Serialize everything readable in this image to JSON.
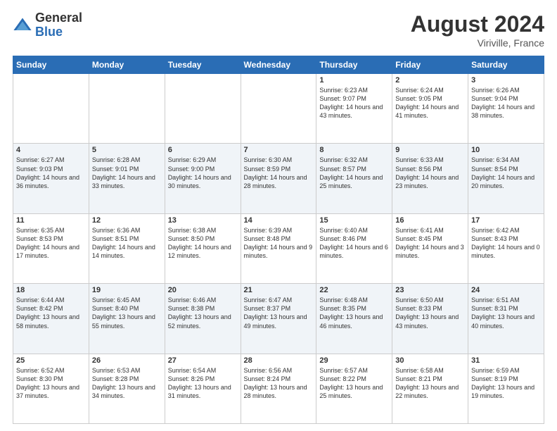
{
  "logo": {
    "general": "General",
    "blue": "Blue"
  },
  "title": "August 2024",
  "location": "Viriville, France",
  "days": [
    "Sunday",
    "Monday",
    "Tuesday",
    "Wednesday",
    "Thursday",
    "Friday",
    "Saturday"
  ],
  "weeks": [
    [
      {
        "day": "",
        "info": ""
      },
      {
        "day": "",
        "info": ""
      },
      {
        "day": "",
        "info": ""
      },
      {
        "day": "",
        "info": ""
      },
      {
        "day": "1",
        "info": "Sunrise: 6:23 AM\nSunset: 9:07 PM\nDaylight: 14 hours and 43 minutes."
      },
      {
        "day": "2",
        "info": "Sunrise: 6:24 AM\nSunset: 9:05 PM\nDaylight: 14 hours and 41 minutes."
      },
      {
        "day": "3",
        "info": "Sunrise: 6:26 AM\nSunset: 9:04 PM\nDaylight: 14 hours and 38 minutes."
      }
    ],
    [
      {
        "day": "4",
        "info": "Sunrise: 6:27 AM\nSunset: 9:03 PM\nDaylight: 14 hours and 36 minutes."
      },
      {
        "day": "5",
        "info": "Sunrise: 6:28 AM\nSunset: 9:01 PM\nDaylight: 14 hours and 33 minutes."
      },
      {
        "day": "6",
        "info": "Sunrise: 6:29 AM\nSunset: 9:00 PM\nDaylight: 14 hours and 30 minutes."
      },
      {
        "day": "7",
        "info": "Sunrise: 6:30 AM\nSunset: 8:59 PM\nDaylight: 14 hours and 28 minutes."
      },
      {
        "day": "8",
        "info": "Sunrise: 6:32 AM\nSunset: 8:57 PM\nDaylight: 14 hours and 25 minutes."
      },
      {
        "day": "9",
        "info": "Sunrise: 6:33 AM\nSunset: 8:56 PM\nDaylight: 14 hours and 23 minutes."
      },
      {
        "day": "10",
        "info": "Sunrise: 6:34 AM\nSunset: 8:54 PM\nDaylight: 14 hours and 20 minutes."
      }
    ],
    [
      {
        "day": "11",
        "info": "Sunrise: 6:35 AM\nSunset: 8:53 PM\nDaylight: 14 hours and 17 minutes."
      },
      {
        "day": "12",
        "info": "Sunrise: 6:36 AM\nSunset: 8:51 PM\nDaylight: 14 hours and 14 minutes."
      },
      {
        "day": "13",
        "info": "Sunrise: 6:38 AM\nSunset: 8:50 PM\nDaylight: 14 hours and 12 minutes."
      },
      {
        "day": "14",
        "info": "Sunrise: 6:39 AM\nSunset: 8:48 PM\nDaylight: 14 hours and 9 minutes."
      },
      {
        "day": "15",
        "info": "Sunrise: 6:40 AM\nSunset: 8:46 PM\nDaylight: 14 hours and 6 minutes."
      },
      {
        "day": "16",
        "info": "Sunrise: 6:41 AM\nSunset: 8:45 PM\nDaylight: 14 hours and 3 minutes."
      },
      {
        "day": "17",
        "info": "Sunrise: 6:42 AM\nSunset: 8:43 PM\nDaylight: 14 hours and 0 minutes."
      }
    ],
    [
      {
        "day": "18",
        "info": "Sunrise: 6:44 AM\nSunset: 8:42 PM\nDaylight: 13 hours and 58 minutes."
      },
      {
        "day": "19",
        "info": "Sunrise: 6:45 AM\nSunset: 8:40 PM\nDaylight: 13 hours and 55 minutes."
      },
      {
        "day": "20",
        "info": "Sunrise: 6:46 AM\nSunset: 8:38 PM\nDaylight: 13 hours and 52 minutes."
      },
      {
        "day": "21",
        "info": "Sunrise: 6:47 AM\nSunset: 8:37 PM\nDaylight: 13 hours and 49 minutes."
      },
      {
        "day": "22",
        "info": "Sunrise: 6:48 AM\nSunset: 8:35 PM\nDaylight: 13 hours and 46 minutes."
      },
      {
        "day": "23",
        "info": "Sunrise: 6:50 AM\nSunset: 8:33 PM\nDaylight: 13 hours and 43 minutes."
      },
      {
        "day": "24",
        "info": "Sunrise: 6:51 AM\nSunset: 8:31 PM\nDaylight: 13 hours and 40 minutes."
      }
    ],
    [
      {
        "day": "25",
        "info": "Sunrise: 6:52 AM\nSunset: 8:30 PM\nDaylight: 13 hours and 37 minutes."
      },
      {
        "day": "26",
        "info": "Sunrise: 6:53 AM\nSunset: 8:28 PM\nDaylight: 13 hours and 34 minutes."
      },
      {
        "day": "27",
        "info": "Sunrise: 6:54 AM\nSunset: 8:26 PM\nDaylight: 13 hours and 31 minutes."
      },
      {
        "day": "28",
        "info": "Sunrise: 6:56 AM\nSunset: 8:24 PM\nDaylight: 13 hours and 28 minutes."
      },
      {
        "day": "29",
        "info": "Sunrise: 6:57 AM\nSunset: 8:22 PM\nDaylight: 13 hours and 25 minutes."
      },
      {
        "day": "30",
        "info": "Sunrise: 6:58 AM\nSunset: 8:21 PM\nDaylight: 13 hours and 22 minutes."
      },
      {
        "day": "31",
        "info": "Sunrise: 6:59 AM\nSunset: 8:19 PM\nDaylight: 13 hours and 19 minutes."
      }
    ]
  ]
}
